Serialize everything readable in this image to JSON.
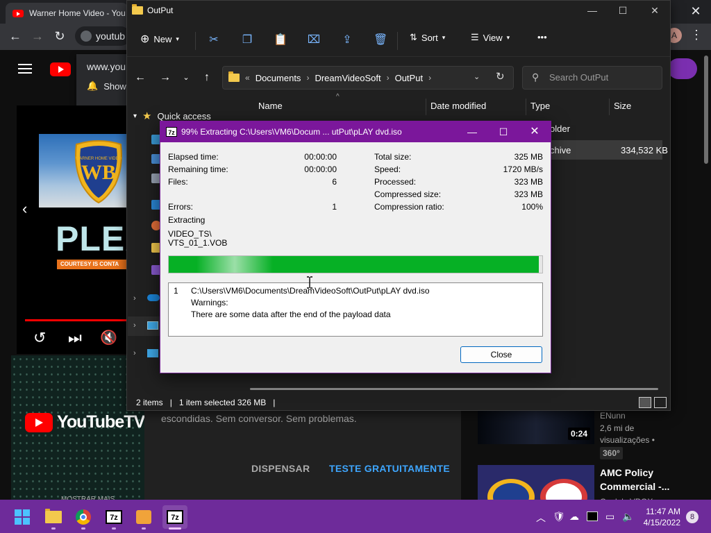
{
  "chrome": {
    "tab_title": "Warner Home Video - You",
    "url_text": "youtub",
    "popup_url": "www.you",
    "popup_show": "Show",
    "avatar_letter": "A"
  },
  "youtube": {
    "pleas_text": "PLEAS",
    "courtesy_text": "COURTESY IS CONTA",
    "wb_shield_text": "WARNER HOME VIDEO",
    "ytv_text": "YouTubeTV",
    "promo_text": "escondidas. Sem conversor. Sem problemas.",
    "dismiss_label": "DISPENSAR",
    "trial_label": "TESTE GRATUITAMENTE",
    "mostrar": "MOSTRAR MAIS",
    "rec1": {
      "channel": "ENunn",
      "views": "2,6 mi de",
      "views2": "visualizações •",
      "duration": "0:24",
      "badge": "360°"
    },
    "rec2": {
      "title_line1": "AMC Policy",
      "title_line2": "Commercial -...",
      "channel": "Coole's VBOX"
    }
  },
  "explorer": {
    "title": "OutPut",
    "commands": {
      "new": "New",
      "sort": "Sort",
      "view": "View",
      "more": "•••"
    },
    "address": {
      "crumbs": [
        "Documents",
        "DreamVideoSoft",
        "OutPut"
      ],
      "overflow": "«"
    },
    "search_placeholder": "Search OutPut",
    "columns": {
      "name": "Name",
      "date": "Date modified",
      "type": "Type",
      "size": "Size"
    },
    "nav": {
      "quick_access": "Quick access"
    },
    "rows": [
      {
        "type": "older",
        "size": ""
      },
      {
        "type": "chive",
        "size": "334,532 KB"
      }
    ],
    "status": {
      "items": "2 items",
      "selected": "1 item selected  326 MB"
    }
  },
  "zip": {
    "title": "99% Extracting C:\\Users\\VM6\\Docum ... utPut\\pLAY dvd.iso",
    "icon_text": "7z",
    "left": [
      {
        "label": "Elapsed time:",
        "value": "00:00:00"
      },
      {
        "label": "Remaining time:",
        "value": "00:00:00"
      },
      {
        "label": "Files:",
        "value": "6"
      },
      {
        "label": "Errors:",
        "value": "1"
      }
    ],
    "right": [
      {
        "label": "Total size:",
        "value": "325 MB"
      },
      {
        "label": "Speed:",
        "value": "1720 MB/s"
      },
      {
        "label": "Processed:",
        "value": "323 MB"
      },
      {
        "label": "Compressed size:",
        "value": "323 MB"
      },
      {
        "label": "Compression ratio:",
        "value": "100%"
      }
    ],
    "extracting_label": "Extracting",
    "current_dir": "VIDEO_TS\\",
    "current_file": "VTS_01_1.VOB",
    "progress_fraction": 0.99,
    "progress_color": "#06b025",
    "log": {
      "index": "1",
      "path": "C:\\Users\\VM6\\Documents\\DreamVideoSoft\\OutPut\\pLAY dvd.iso",
      "warnings_label": "Warnings:",
      "message": "There are some data after the end of the payload data"
    },
    "close_label": "Close"
  },
  "taskbar": {
    "sevenzip_label": "7z",
    "time": "11:47 AM",
    "date": "4/15/2022",
    "notifications": "8",
    "accent": "#6e2b9a"
  }
}
